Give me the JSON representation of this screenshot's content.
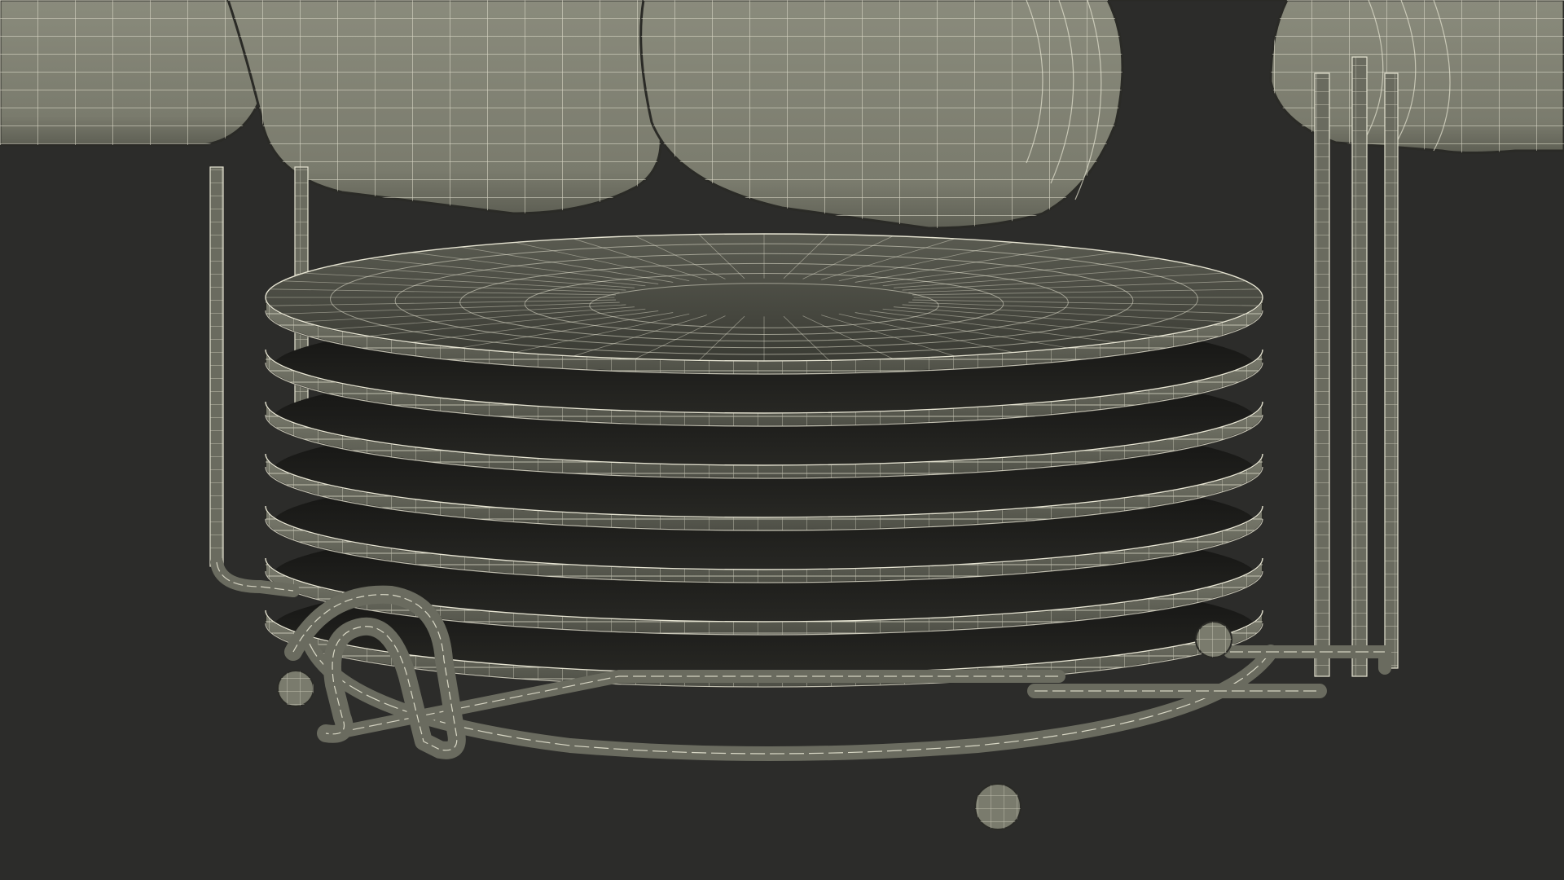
{
  "scene": {
    "subject": "wireframe-render",
    "colors": {
      "background": "#2c2c2a",
      "surface_light": "#8e8f80",
      "surface_mid": "#6f7064",
      "surface_dark": "#4a4b42",
      "wire": "#e6e4d2",
      "wire_dim": "#c9c7b4",
      "shadow": "#1c1c1a"
    },
    "plate_count": 7,
    "cup_count": 4,
    "icons": [
      "mug-icon",
      "plate-icon",
      "rack-icon"
    ]
  }
}
